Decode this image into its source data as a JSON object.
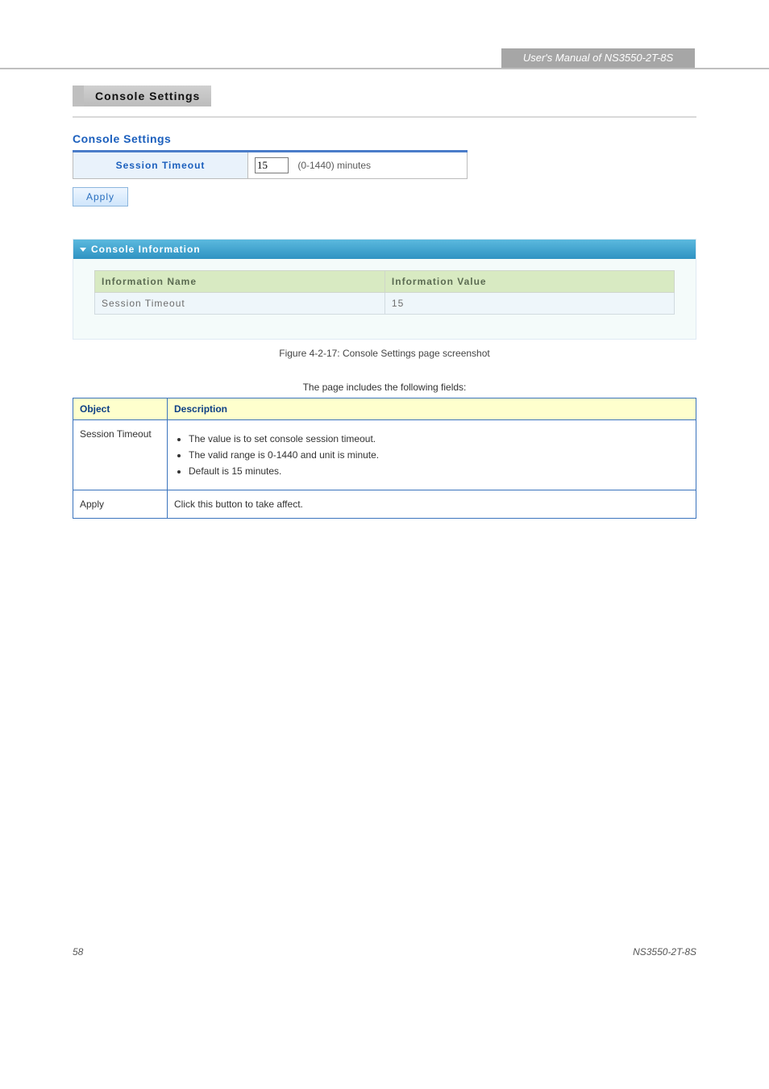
{
  "topbar": {
    "manual_tab": "User's Manual of NS3550-2T-8S"
  },
  "panel": {
    "title": "Console Settings"
  },
  "figure1": "Figure 4-2-17: Console Settings page screenshot",
  "form": {
    "heading": "Console Settings",
    "label": "Session Timeout",
    "value": "15",
    "hint": "(0-1440) minutes",
    "apply": "Apply"
  },
  "info": {
    "header": "Console Information",
    "cols": {
      "name": "Information Name",
      "value": "Information Value"
    },
    "row": {
      "name": "Session Timeout",
      "value": "15"
    }
  },
  "desc": {
    "caption": "The page includes the following fields:",
    "cols": {
      "object": "Object",
      "description": "Description"
    },
    "rows": [
      {
        "object": "Session Timeout",
        "lines": [
          "The value is to set console session timeout.",
          "The valid range is 0-1440 and unit is minute.",
          "Default is 15 minutes."
        ]
      },
      {
        "object": "Apply",
        "text": "Click this button to take affect."
      }
    ]
  },
  "footer": {
    "page": "58",
    "model": "NS3550-2T-8S"
  }
}
